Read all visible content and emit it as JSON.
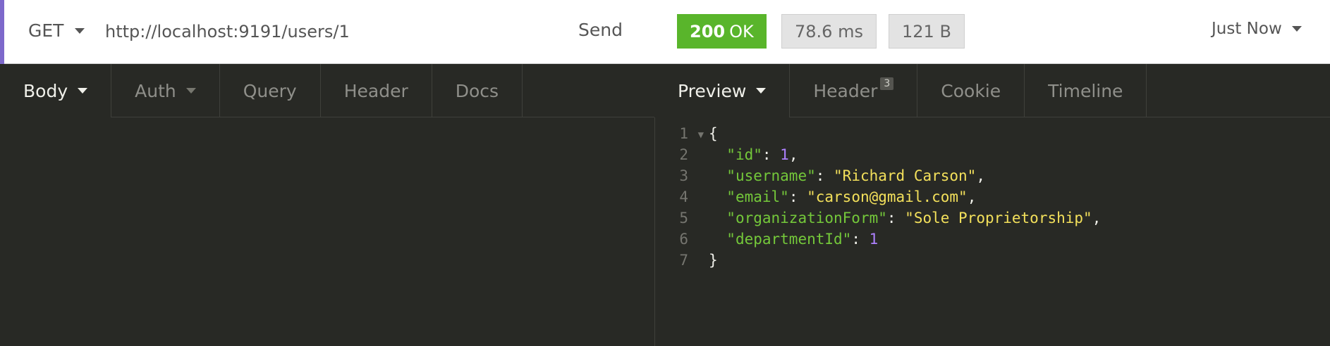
{
  "request": {
    "method": "GET",
    "url": "http://localhost:9191/users/1",
    "send_label": "Send"
  },
  "response": {
    "status_code": "200",
    "status_text": "OK",
    "time": "78.6 ms",
    "size": "121 B",
    "history_label": "Just Now"
  },
  "request_tabs": [
    "Body",
    "Auth",
    "Query",
    "Header",
    "Docs"
  ],
  "response_tabs": {
    "preview": "Preview",
    "header": "Header",
    "header_count": "3",
    "cookie": "Cookie",
    "timeline": "Timeline"
  },
  "body": {
    "line_numbers": [
      "1",
      "2",
      "3",
      "4",
      "5",
      "6",
      "7"
    ],
    "open_brace": "{",
    "close_brace": "}",
    "fields": [
      {
        "key": "\"id\"",
        "value": "1",
        "type": "number"
      },
      {
        "key": "\"username\"",
        "value": "\"Richard Carson\"",
        "type": "string"
      },
      {
        "key": "\"email\"",
        "value": "\"carson@gmail.com\"",
        "type": "string"
      },
      {
        "key": "\"organizationForm\"",
        "value": "\"Sole Proprietorship\"",
        "type": "string"
      },
      {
        "key": "\"departmentId\"",
        "value": "1",
        "type": "number"
      }
    ]
  },
  "colors": {
    "accent": "#7d69cb",
    "status_ok": "#59b52b",
    "json_key": "#74c83a",
    "json_string": "#f3e05b",
    "json_number": "#ae81ff"
  },
  "icons": {
    "method_dropdown": "chevron-down-icon",
    "fold": "fold-triangle-icon"
  }
}
